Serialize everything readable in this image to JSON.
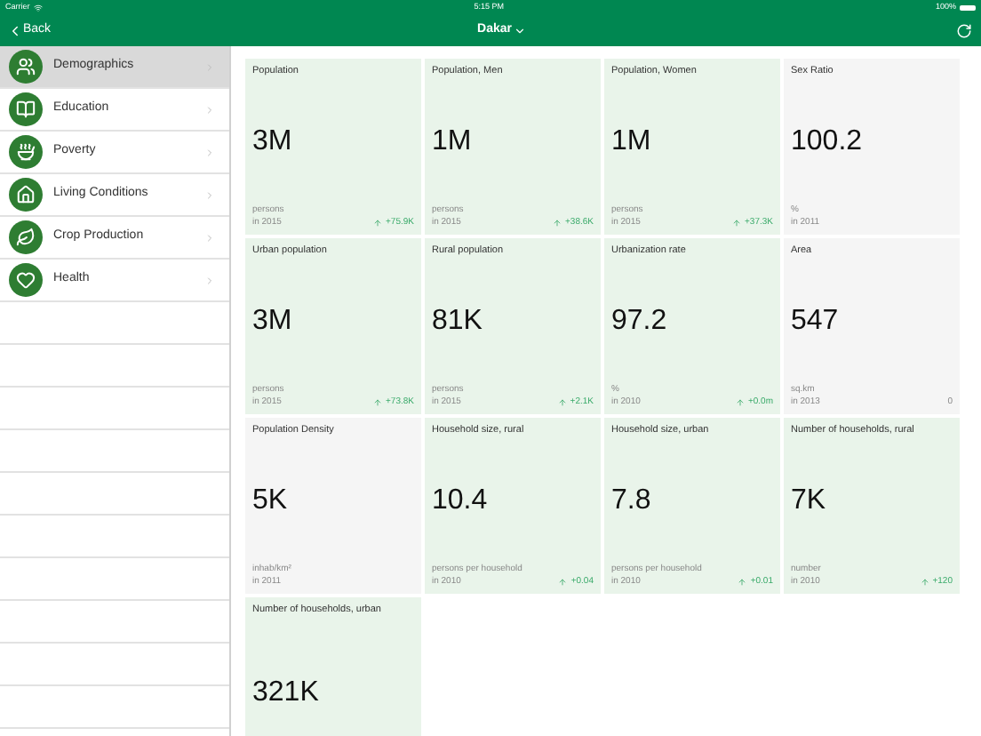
{
  "status_bar": {
    "carrier": "Carrier",
    "time": "5:15 PM",
    "battery": "100%"
  },
  "nav": {
    "back": "Back",
    "title": "Dakar"
  },
  "sidebar": {
    "items": [
      {
        "label": "Demographics",
        "kind": "people",
        "selected": true
      },
      {
        "label": "Education",
        "kind": "book",
        "selected": false
      },
      {
        "label": "Poverty",
        "kind": "bowl",
        "selected": false
      },
      {
        "label": "Living Conditions",
        "kind": "house",
        "selected": false
      },
      {
        "label": "Crop Production",
        "kind": "leaf",
        "selected": false
      },
      {
        "label": "Health",
        "kind": "heart",
        "selected": false
      }
    ]
  },
  "cards": [
    {
      "title": "Population",
      "value": "3M",
      "unit": "persons",
      "year": "in 2015",
      "change": "+75.9K",
      "highlighted": true
    },
    {
      "title": "Population, Men",
      "value": "1M",
      "unit": "persons",
      "year": "in 2015",
      "change": "+38.6K",
      "highlighted": true
    },
    {
      "title": "Population, Women",
      "value": "1M",
      "unit": "persons",
      "year": "in 2015",
      "change": "+37.3K",
      "highlighted": true
    },
    {
      "title": "Sex Ratio",
      "value": "100.2",
      "unit": "%",
      "year": "in 2011",
      "highlighted": false
    },
    {
      "title": "Urban population",
      "value": "3M",
      "unit": "persons",
      "year": "in 2015",
      "change": "+73.8K",
      "highlighted": true
    },
    {
      "title": "Rural population",
      "value": "81K",
      "unit": "persons",
      "year": "in 2015",
      "change": "+2.1K",
      "highlighted": true
    },
    {
      "title": "Urbanization rate",
      "value": "97.2",
      "unit": "%",
      "year": "in 2010",
      "change": "+0.0m",
      "highlighted": true
    },
    {
      "title": "Area",
      "value": "547",
      "unit": "sq.km",
      "year": "in 2013",
      "change": "0",
      "highlighted": false
    },
    {
      "title": "Population Density",
      "value": "5K",
      "unit": "inhab/km²",
      "year": "in 2011",
      "highlighted": false
    },
    {
      "title": "Household size, rural",
      "value": "10.4",
      "unit": "persons per household",
      "year": "in 2010",
      "change": "+0.04",
      "highlighted": true
    },
    {
      "title": "Household size, urban",
      "value": "7.8",
      "unit": "persons per household",
      "year": "in 2010",
      "change": "+0.01",
      "highlighted": true
    },
    {
      "title": "Number of households, rural",
      "value": "7K",
      "unit": "number",
      "year": "in 2010",
      "change": "+120",
      "highlighted": true
    },
    {
      "title": "Number of households, urban",
      "value": "321K",
      "highlighted": true
    }
  ]
}
